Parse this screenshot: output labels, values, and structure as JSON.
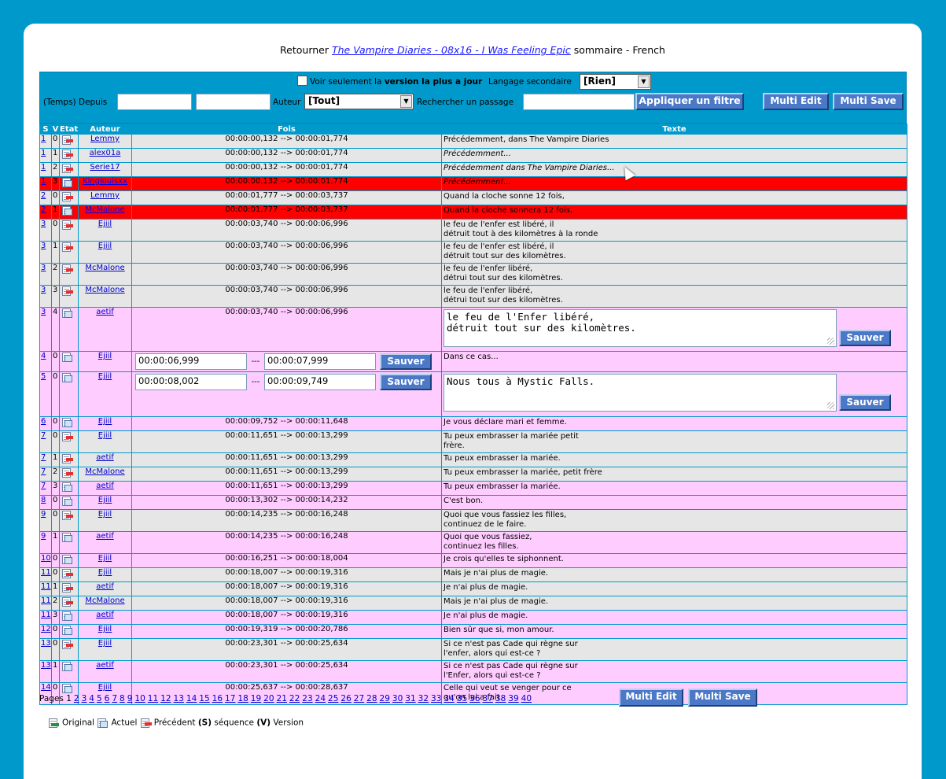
{
  "header": {
    "prefix": "Retourner",
    "link": "The Vampire Diaries - 08x16 - I Was Feeling Epic",
    "suffix": "sommaire - French"
  },
  "filters": {
    "only_latest_text": "Voir seulement la",
    "only_latest_bold": "version la plus a jour",
    "secondary_lang_label": "Langage secondaire",
    "secondary_lang_value": "[Rien]",
    "time_label": "(Temps) Depuis",
    "author_label": "Auteur",
    "author_value": "[Tout]",
    "search_label": "Rechercher un passage",
    "apply_button": "Appliquer un filtre",
    "multi_edit": "Multi Edit",
    "multi_save": "Multi Save"
  },
  "columns": {
    "s": "S",
    "v": "V",
    "etat": "Etat",
    "auteur": "Auteur",
    "fois": "Fois",
    "texte": "Texte"
  },
  "save_label": "Sauver",
  "rows": [
    {
      "s": "1",
      "v": "0",
      "icon": "prev",
      "author": "Lemmy",
      "time": "00:00:00,132 --> 00:00:01,774",
      "lines": [
        "Précédemment, dans The Vampire Diaries"
      ],
      "bg": "gray"
    },
    {
      "s": "1",
      "v": "1",
      "icon": "prev",
      "author": "alex01a",
      "time": "00:00:00,132 --> 00:00:01,774",
      "lines": [
        "Précédemment..."
      ],
      "bg": "gray",
      "italic": true
    },
    {
      "s": "1",
      "v": "2",
      "icon": "prev",
      "author": "Serie17",
      "time": "00:00:00,132 --> 00:00:01,774",
      "lines": [
        "Précédemment dans The Vampire Diaries..."
      ],
      "bg": "gray",
      "italic": true
    },
    {
      "s": "1",
      "v": "3",
      "icon": "cur",
      "author": "Kinglouisxx",
      "time": "00:00:00,132 --> 00:00:01,774",
      "lines": [
        "Précédemment..."
      ],
      "bg": "red",
      "italic": true
    },
    {
      "s": "2",
      "v": "0",
      "icon": "prev",
      "author": "Lemmy",
      "time": "00:00:01,777 --> 00:00:03,737",
      "lines": [
        "Quand la cloche sonne 12 fois,"
      ],
      "bg": "gray"
    },
    {
      "s": "2",
      "v": "1",
      "icon": "cur",
      "author": "McMalone",
      "time": "00:00:01,777 --> 00:00:03,737",
      "lines": [
        "Quand la cloche sonnera 12 fois,"
      ],
      "bg": "red"
    },
    {
      "s": "3",
      "v": "0",
      "icon": "prev",
      "author": "Ejiil",
      "time": "00:00:03,740 --> 00:00:06,996",
      "lines": [
        "le feu de l'enfer est libéré, il",
        "détruit tout à des kilomètres à la ronde"
      ],
      "bg": "gray"
    },
    {
      "s": "3",
      "v": "1",
      "icon": "prev",
      "author": "Ejiil",
      "time": "00:00:03,740 --> 00:00:06,996",
      "lines": [
        "le feu de l'enfer est libéré, il",
        "détruit tout sur des kilomètres."
      ],
      "bg": "gray"
    },
    {
      "s": "3",
      "v": "2",
      "icon": "prev",
      "author": "McMalone",
      "time": "00:00:03,740 --> 00:00:06,996",
      "lines": [
        "le feu de l'enfer libéré,",
        "détrui tout sur des kilomètres."
      ],
      "bg": "gray"
    },
    {
      "s": "3",
      "v": "3",
      "icon": "prev",
      "author": "McMalone",
      "time": "00:00:03,740 --> 00:00:06,996",
      "lines": [
        "le feu de l'enfer libéré,",
        "détrui tout sur des kilomètres."
      ],
      "bg": "gray"
    },
    {
      "s": "3",
      "v": "4",
      "icon": "cur",
      "author": "aetif",
      "time": "00:00:03,740 --> 00:00:06,996",
      "lines": [],
      "edit_text": "le feu de l'Enfer libéré,\ndétruit tout sur des kilomètres.",
      "bg": "pink",
      "mode": "text-edit"
    },
    {
      "s": "4",
      "v": "0",
      "icon": "cur",
      "author": "Ejiil",
      "time_start": "00:00:06,999",
      "time_end": "00:00:07,999",
      "lines": [
        "Dans ce cas..."
      ],
      "bg": "pink",
      "mode": "time-edit"
    },
    {
      "s": "5",
      "v": "0",
      "icon": "cur",
      "author": "Ejiil",
      "time_start": "00:00:08,002",
      "time_end": "00:00:09,749",
      "lines": [],
      "edit_text": "Nous tous à Mystic Falls.",
      "bg": "pink",
      "mode": "both-edit"
    },
    {
      "s": "6",
      "v": "0",
      "icon": "cur",
      "author": "Ejiil",
      "time": "00:00:09,752 --> 00:00:11,648",
      "lines": [
        "Je vous déclare mari et femme."
      ],
      "bg": "pink"
    },
    {
      "s": "7",
      "v": "0",
      "icon": "prev",
      "author": "Ejiil",
      "time": "00:00:11,651 --> 00:00:13,299",
      "lines": [
        "Tu peux embrasser la mariée petit",
        "frère."
      ],
      "bg": "gray"
    },
    {
      "s": "7",
      "v": "1",
      "icon": "prev",
      "author": "aetif",
      "time": "00:00:11,651 --> 00:00:13,299",
      "lines": [
        "Tu peux embrasser la mariée."
      ],
      "bg": "gray"
    },
    {
      "s": "7",
      "v": "2",
      "icon": "prev",
      "author": "McMalone",
      "time": "00:00:11,651 --> 00:00:13,299",
      "lines": [
        "Tu peux embrasser la mariée, petit frère"
      ],
      "bg": "gray"
    },
    {
      "s": "7",
      "v": "3",
      "icon": "cur",
      "author": "aetif",
      "time": "00:00:11,651 --> 00:00:13,299",
      "lines": [
        "Tu peux embrasser la mariée."
      ],
      "bg": "pink"
    },
    {
      "s": "8",
      "v": "0",
      "icon": "cur",
      "author": "Ejiil",
      "time": "00:00:13,302 --> 00:00:14,232",
      "lines": [
        "C'est bon."
      ],
      "bg": "pink"
    },
    {
      "s": "9",
      "v": "0",
      "icon": "prev",
      "author": "Ejiil",
      "time": "00:00:14,235 --> 00:00:16,248",
      "lines": [
        "Quoi que vous fassiez les filles,",
        "continuez de le faire."
      ],
      "bg": "gray"
    },
    {
      "s": "9",
      "v": "1",
      "icon": "cur",
      "author": "aetif",
      "time": "00:00:14,235 --> 00:00:16,248",
      "lines": [
        "Quoi que vous fassiez,",
        "continuez les filles."
      ],
      "bg": "pink"
    },
    {
      "s": "10",
      "v": "0",
      "icon": "cur",
      "author": "Ejiil",
      "time": "00:00:16,251 --> 00:00:18,004",
      "lines": [
        "Je crois qu'elles te siphonnent."
      ],
      "bg": "pink"
    },
    {
      "s": "11",
      "v": "0",
      "icon": "prev",
      "author": "Ejiil",
      "time": "00:00:18,007 --> 00:00:19,316",
      "lines": [
        "Mais je n'ai plus de magie."
      ],
      "bg": "gray"
    },
    {
      "s": "11",
      "v": "1",
      "icon": "prev",
      "author": "aetif",
      "time": "00:00:18,007 --> 00:00:19,316",
      "lines": [
        "Je n'ai plus de magie."
      ],
      "bg": "gray"
    },
    {
      "s": "11",
      "v": "2",
      "icon": "prev",
      "author": "McMalone",
      "time": "00:00:18,007 --> 00:00:19,316",
      "lines": [
        "Mais je n'ai plus de magie."
      ],
      "bg": "gray"
    },
    {
      "s": "11",
      "v": "3",
      "icon": "cur",
      "author": "aetif",
      "time": "00:00:18,007 --> 00:00:19,316",
      "lines": [
        "Je n'ai plus de magie."
      ],
      "bg": "pink"
    },
    {
      "s": "12",
      "v": "0",
      "icon": "cur",
      "author": "Ejiil",
      "time": "00:00:19,319 --> 00:00:20,786",
      "lines": [
        "Bien sûr que si, mon amour."
      ],
      "bg": "pink"
    },
    {
      "s": "13",
      "v": "0",
      "icon": "prev",
      "author": "Ejiil",
      "time": "00:00:23,301 --> 00:00:25,634",
      "lines": [
        "Si ce n'est pas Cade qui règne sur",
        "l'enfer, alors qui est-ce ?"
      ],
      "bg": "gray"
    },
    {
      "s": "13",
      "v": "1",
      "icon": "cur",
      "author": "aetif",
      "time": "00:00:23,301 --> 00:00:25,634",
      "lines": [
        "Si ce n'est pas Cade qui règne sur",
        "l'Enfer, alors qui est-ce ?"
      ],
      "bg": "pink"
    },
    {
      "s": "14",
      "v": "0",
      "icon": "cur",
      "author": "Ejiil",
      "time": "00:00:25,637 --> 00:00:28,637",
      "lines": [
        "Celle qui veut se venger pour ce",
        "qu'on lui a fait."
      ],
      "bg": "pink"
    }
  ],
  "pager": {
    "label": "Pages",
    "current": "1",
    "pages": [
      "2",
      "3",
      "4",
      "5",
      "6",
      "7",
      "8",
      "9",
      "10",
      "11",
      "12",
      "13",
      "14",
      "15",
      "16",
      "17",
      "18",
      "19",
      "20",
      "21",
      "22",
      "23",
      "24",
      "25",
      "26",
      "27",
      "28",
      "29",
      "30",
      "31",
      "32",
      "33",
      "34",
      "35",
      "36",
      "37",
      "38",
      "39",
      "40"
    ]
  },
  "legend": {
    "original": "Original",
    "actuel": "Actuel",
    "precedent": "Précédent",
    "s_key": "(S)",
    "sequence": "séquence",
    "v_key": "(V)",
    "version": "Version"
  }
}
